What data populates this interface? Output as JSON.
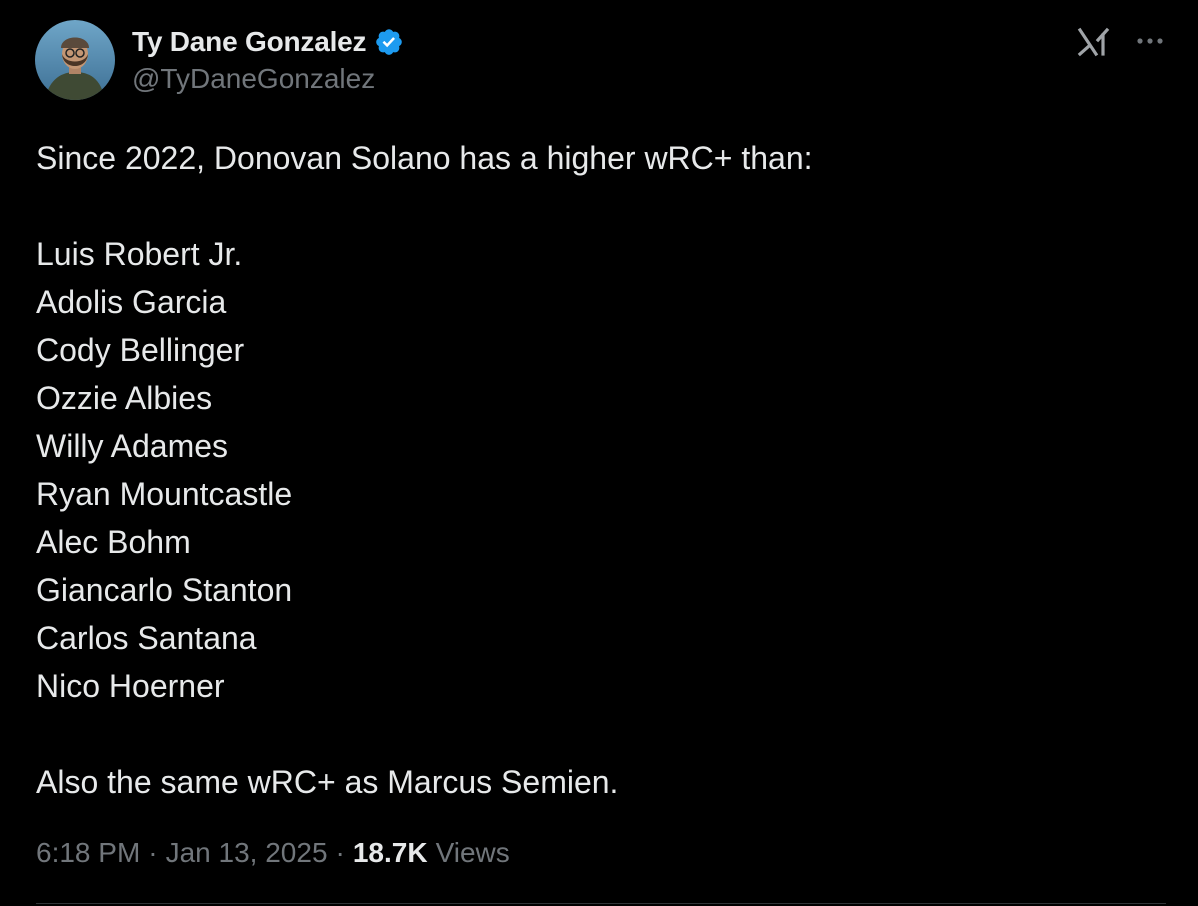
{
  "author": {
    "display_name": "Ty Dane Gonzalez",
    "handle": "@TyDaneGonzalez",
    "verified": true,
    "avatar": "profile-photo"
  },
  "header_icons": {
    "grok": "grok-icon",
    "more": "more-horizontal-icon"
  },
  "tweet": {
    "intro": "Since 2022, Donovan Solano has a higher wRC+ than:",
    "players": [
      "Luis Robert Jr.",
      "Adolis Garcia",
      "Cody Bellinger",
      "Ozzie Albies",
      "Willy Adames",
      "Ryan Mountcastle",
      "Alec Bohm",
      "Giancarlo Stanton",
      "Carlos Santana",
      "Nico Hoerner"
    ],
    "outro": "Also the same wRC+ as Marcus Semien."
  },
  "meta": {
    "time": "6:18 PM",
    "separator": "·",
    "date": "Jan 13, 2025",
    "views_count": "18.7K",
    "views_label": "Views"
  },
  "colors": {
    "background": "#000000",
    "text_primary": "#e7e9ea",
    "text_secondary": "#71767b",
    "verified_blue": "#1d9bf0",
    "divider": "#2f3336"
  }
}
